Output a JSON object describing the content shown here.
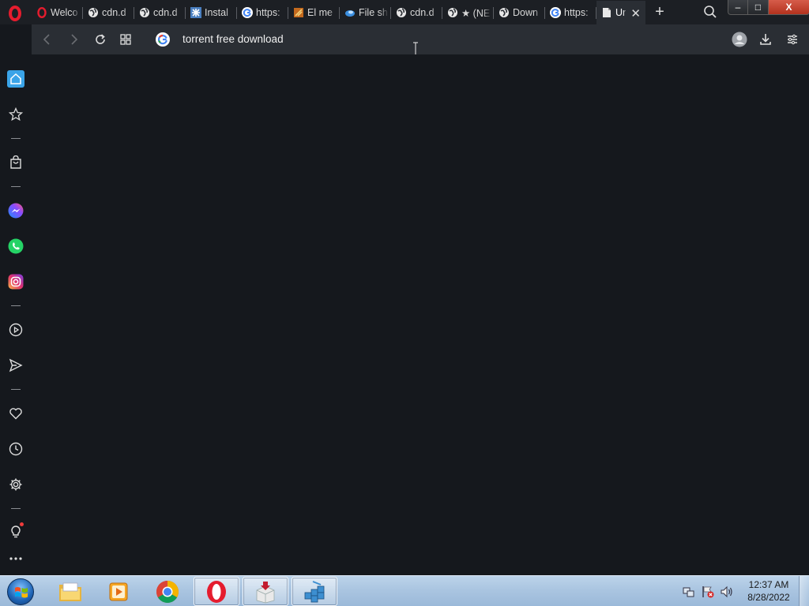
{
  "browser": {
    "tabs": [
      {
        "title": "Welco",
        "icon": "opera-icon"
      },
      {
        "title": "cdn.d",
        "icon": "globe-icon"
      },
      {
        "title": "cdn.d",
        "icon": "globe-icon"
      },
      {
        "title": "Instal",
        "icon": "puzzle-icon"
      },
      {
        "title": "https:",
        "icon": "google-icon"
      },
      {
        "title": "El me",
        "icon": "site-icon"
      },
      {
        "title": "File sh",
        "icon": "cloud-icon"
      },
      {
        "title": "cdn.d",
        "icon": "globe-icon"
      },
      {
        "title": "★ (NE",
        "icon": "globe-icon"
      },
      {
        "title": "Down",
        "icon": "globe-icon"
      },
      {
        "title": "https:",
        "icon": "google-icon"
      },
      {
        "title": "Ur",
        "icon": "page-icon",
        "active": true
      }
    ],
    "new_tab_label": "+",
    "address": {
      "text": "torrent free download"
    }
  },
  "window_controls": {
    "minimize": "–",
    "maximize": "□",
    "close": "X"
  },
  "taskbar": {
    "apps": [
      {
        "name": "windows-explorer",
        "open": false
      },
      {
        "name": "media-player",
        "open": false
      },
      {
        "name": "chrome",
        "open": false
      },
      {
        "name": "opera",
        "open": true
      },
      {
        "name": "installer",
        "open": true
      },
      {
        "name": "registry-editor",
        "open": true
      }
    ],
    "clock_time": "12:37 AM",
    "clock_date": "8/28/2022"
  },
  "colors": {
    "accent": "#3aa4e8",
    "opera_red": "#e51c2e",
    "background": "#15181d"
  }
}
